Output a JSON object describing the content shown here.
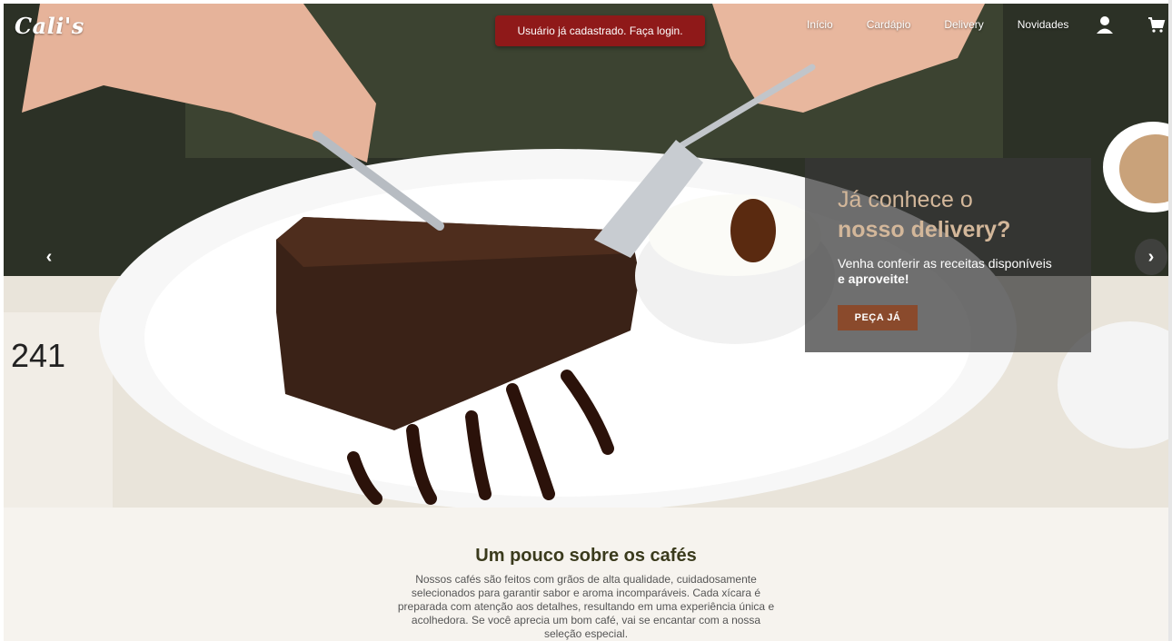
{
  "header": {
    "brand": "Cali's",
    "alert_message": "Usuário já cadastrado. Faça login.",
    "nav": [
      {
        "label": "Início"
      },
      {
        "label": "Cardápio"
      },
      {
        "label": "Delivery"
      },
      {
        "label": "Novidades"
      }
    ],
    "icons": {
      "user": "user-icon",
      "cart": "cart-icon"
    }
  },
  "hero": {
    "prev_label": "‹",
    "next_label": "›",
    "promo": {
      "title_line1": "Já conhece o",
      "title_line2": "nosso delivery?",
      "text_line1": "Venha conferir as receitas disponíveis",
      "text_line2": "e aproveite!",
      "button_label": "PEÇA JÁ"
    }
  },
  "about": {
    "title": "Um pouco sobre os cafés",
    "text": "Nossos cafés são feitos com grãos de alta qualidade, cuidadosamente selecionados para garantir sabor e aroma incomparáveis. Cada xícara é preparada com atenção aos detalhes, resultando em uma experiência única e acolhedora. Se você aprecia um bom café, vai se encantar com a nossa seleção especial."
  },
  "colors": {
    "alert_bg": "#8f1919",
    "promo_title": "#d3b79a",
    "promo_button": "#8a4a2c",
    "about_bg": "#f6f3ee",
    "about_title": "#3a3a1c"
  }
}
